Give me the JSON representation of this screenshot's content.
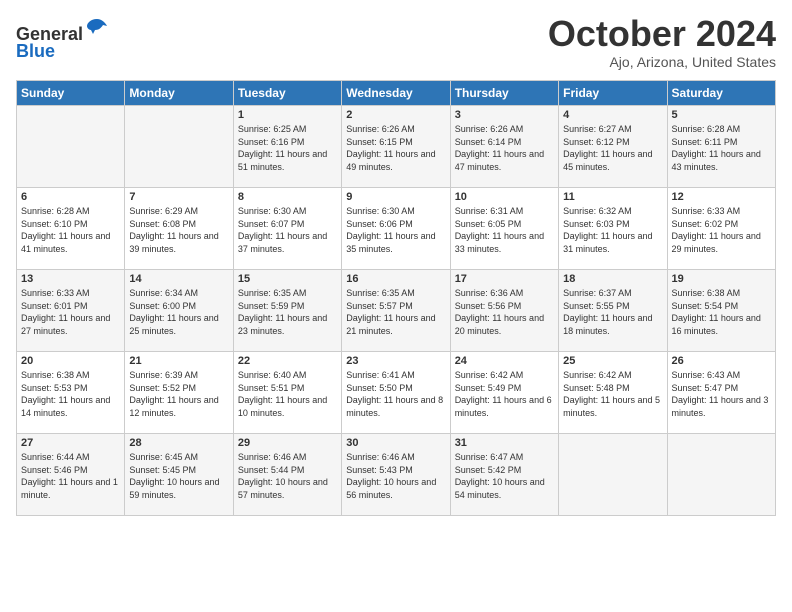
{
  "header": {
    "logo_line1": "General",
    "logo_line2": "Blue",
    "month": "October 2024",
    "location": "Ajo, Arizona, United States"
  },
  "days_of_week": [
    "Sunday",
    "Monday",
    "Tuesday",
    "Wednesday",
    "Thursday",
    "Friday",
    "Saturday"
  ],
  "weeks": [
    [
      {
        "day": "",
        "info": ""
      },
      {
        "day": "",
        "info": ""
      },
      {
        "day": "1",
        "info": "Sunrise: 6:25 AM\nSunset: 6:16 PM\nDaylight: 11 hours and 51 minutes."
      },
      {
        "day": "2",
        "info": "Sunrise: 6:26 AM\nSunset: 6:15 PM\nDaylight: 11 hours and 49 minutes."
      },
      {
        "day": "3",
        "info": "Sunrise: 6:26 AM\nSunset: 6:14 PM\nDaylight: 11 hours and 47 minutes."
      },
      {
        "day": "4",
        "info": "Sunrise: 6:27 AM\nSunset: 6:12 PM\nDaylight: 11 hours and 45 minutes."
      },
      {
        "day": "5",
        "info": "Sunrise: 6:28 AM\nSunset: 6:11 PM\nDaylight: 11 hours and 43 minutes."
      }
    ],
    [
      {
        "day": "6",
        "info": "Sunrise: 6:28 AM\nSunset: 6:10 PM\nDaylight: 11 hours and 41 minutes."
      },
      {
        "day": "7",
        "info": "Sunrise: 6:29 AM\nSunset: 6:08 PM\nDaylight: 11 hours and 39 minutes."
      },
      {
        "day": "8",
        "info": "Sunrise: 6:30 AM\nSunset: 6:07 PM\nDaylight: 11 hours and 37 minutes."
      },
      {
        "day": "9",
        "info": "Sunrise: 6:30 AM\nSunset: 6:06 PM\nDaylight: 11 hours and 35 minutes."
      },
      {
        "day": "10",
        "info": "Sunrise: 6:31 AM\nSunset: 6:05 PM\nDaylight: 11 hours and 33 minutes."
      },
      {
        "day": "11",
        "info": "Sunrise: 6:32 AM\nSunset: 6:03 PM\nDaylight: 11 hours and 31 minutes."
      },
      {
        "day": "12",
        "info": "Sunrise: 6:33 AM\nSunset: 6:02 PM\nDaylight: 11 hours and 29 minutes."
      }
    ],
    [
      {
        "day": "13",
        "info": "Sunrise: 6:33 AM\nSunset: 6:01 PM\nDaylight: 11 hours and 27 minutes."
      },
      {
        "day": "14",
        "info": "Sunrise: 6:34 AM\nSunset: 6:00 PM\nDaylight: 11 hours and 25 minutes."
      },
      {
        "day": "15",
        "info": "Sunrise: 6:35 AM\nSunset: 5:59 PM\nDaylight: 11 hours and 23 minutes."
      },
      {
        "day": "16",
        "info": "Sunrise: 6:35 AM\nSunset: 5:57 PM\nDaylight: 11 hours and 21 minutes."
      },
      {
        "day": "17",
        "info": "Sunrise: 6:36 AM\nSunset: 5:56 PM\nDaylight: 11 hours and 20 minutes."
      },
      {
        "day": "18",
        "info": "Sunrise: 6:37 AM\nSunset: 5:55 PM\nDaylight: 11 hours and 18 minutes."
      },
      {
        "day": "19",
        "info": "Sunrise: 6:38 AM\nSunset: 5:54 PM\nDaylight: 11 hours and 16 minutes."
      }
    ],
    [
      {
        "day": "20",
        "info": "Sunrise: 6:38 AM\nSunset: 5:53 PM\nDaylight: 11 hours and 14 minutes."
      },
      {
        "day": "21",
        "info": "Sunrise: 6:39 AM\nSunset: 5:52 PM\nDaylight: 11 hours and 12 minutes."
      },
      {
        "day": "22",
        "info": "Sunrise: 6:40 AM\nSunset: 5:51 PM\nDaylight: 11 hours and 10 minutes."
      },
      {
        "day": "23",
        "info": "Sunrise: 6:41 AM\nSunset: 5:50 PM\nDaylight: 11 hours and 8 minutes."
      },
      {
        "day": "24",
        "info": "Sunrise: 6:42 AM\nSunset: 5:49 PM\nDaylight: 11 hours and 6 minutes."
      },
      {
        "day": "25",
        "info": "Sunrise: 6:42 AM\nSunset: 5:48 PM\nDaylight: 11 hours and 5 minutes."
      },
      {
        "day": "26",
        "info": "Sunrise: 6:43 AM\nSunset: 5:47 PM\nDaylight: 11 hours and 3 minutes."
      }
    ],
    [
      {
        "day": "27",
        "info": "Sunrise: 6:44 AM\nSunset: 5:46 PM\nDaylight: 11 hours and 1 minute."
      },
      {
        "day": "28",
        "info": "Sunrise: 6:45 AM\nSunset: 5:45 PM\nDaylight: 10 hours and 59 minutes."
      },
      {
        "day": "29",
        "info": "Sunrise: 6:46 AM\nSunset: 5:44 PM\nDaylight: 10 hours and 57 minutes."
      },
      {
        "day": "30",
        "info": "Sunrise: 6:46 AM\nSunset: 5:43 PM\nDaylight: 10 hours and 56 minutes."
      },
      {
        "day": "31",
        "info": "Sunrise: 6:47 AM\nSunset: 5:42 PM\nDaylight: 10 hours and 54 minutes."
      },
      {
        "day": "",
        "info": ""
      },
      {
        "day": "",
        "info": ""
      }
    ]
  ]
}
